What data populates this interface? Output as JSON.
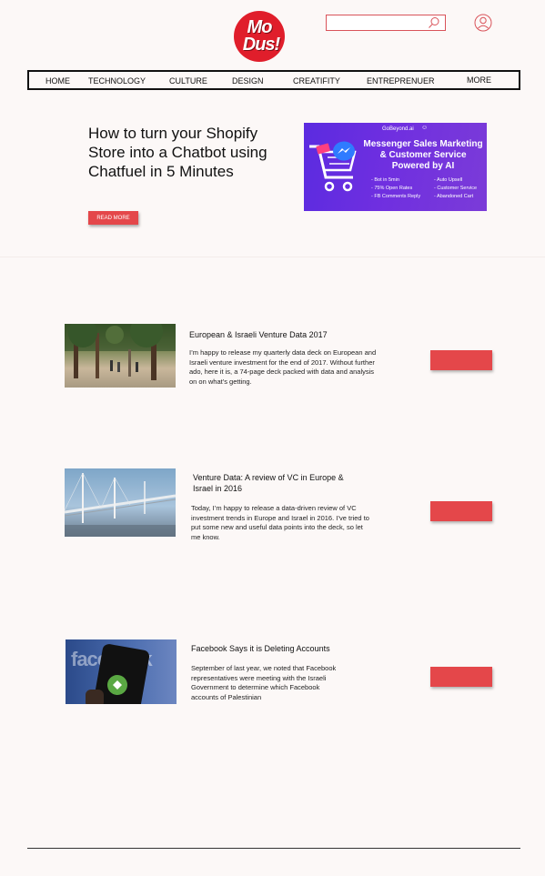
{
  "brand": {
    "logo_line1": "Mo",
    "logo_line2": "Dus!",
    "accent": "#e01e2b",
    "button_color": "#e4474a"
  },
  "header": {
    "search": {
      "placeholder": "",
      "icon": "search-icon"
    },
    "user_icon": "user-icon"
  },
  "nav": {
    "items": [
      "HOME",
      "TECHNOLOGY",
      "CULTURE",
      "DESIGN",
      "CREATIFITY",
      "ENTREPRENUER",
      "MORE"
    ]
  },
  "hero": {
    "title": "How to turn your Shopify Store into a Chatbot using Chatfuel in 5 Minutes",
    "read_more": "READ MORE",
    "ad": {
      "brand": "GoBeyond.ai",
      "headline": "Messenger Sales Marketing & Customer Service Powered by AI",
      "features_left": [
        "- Bot in 5min",
        "- 75% Open Rates",
        "- FB Comments Reply"
      ],
      "features_right": [
        "- Auto Upsell",
        "- Customer Service",
        "- Abandoned Cart"
      ]
    }
  },
  "articles": [
    {
      "title": "European & Israeli Venture Data 2017",
      "body": "I’m happy to release my quarterly data deck on European and Israeli venture investment for the end of 2017. Without further ado, here it is, a 74-page deck packed with data and analysis on on what’s getting."
    },
    {
      "title": "Venture Data: A review of VC in Europe & Israel in 2016",
      "body": "Today, I’m happy to release a data-driven review of VC investment trends in Europe and Israel in 2016. I’ve tried to put some new and useful data points into the deck, so let me know."
    },
    {
      "title": "Facebook Says it is Deleting Accounts",
      "body": "September of last year, we noted that Facebook representatives were meeting with the Israeli Government to determine which Facebook accounts of Palestinian",
      "thumb_text": "facebook"
    }
  ]
}
